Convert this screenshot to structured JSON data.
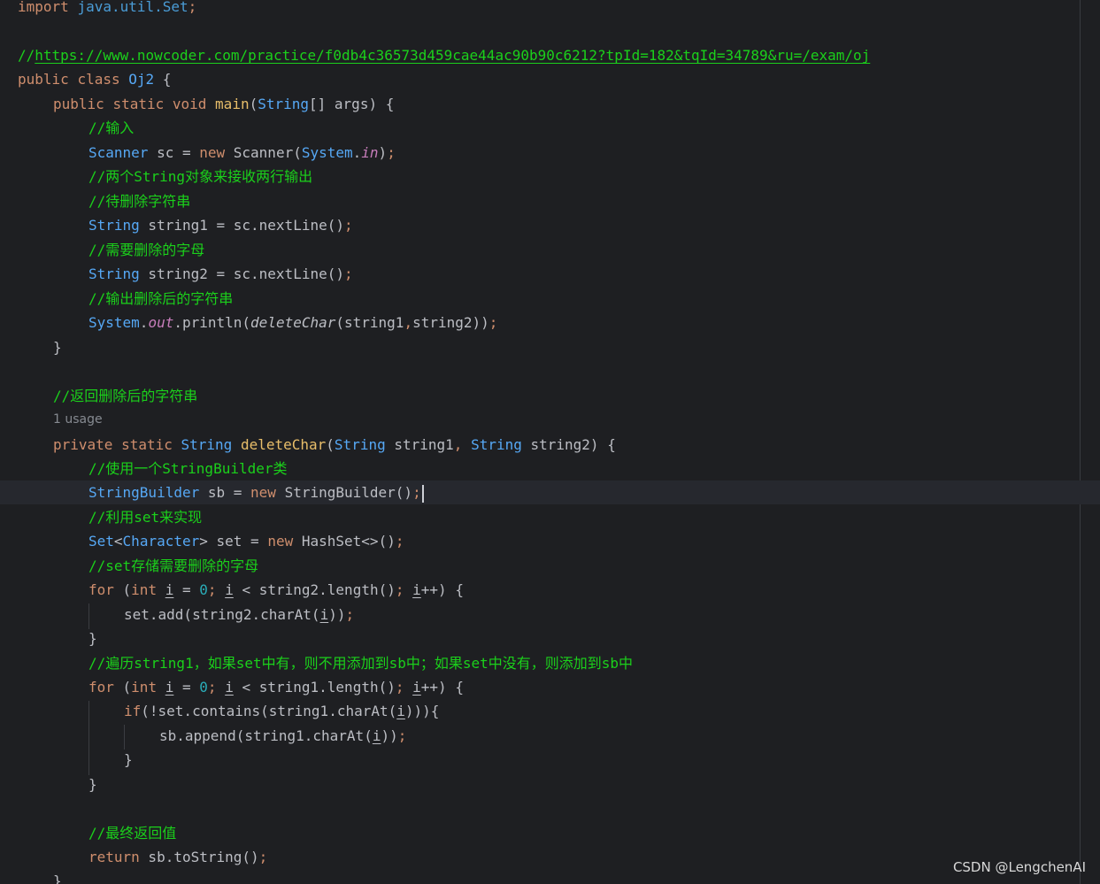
{
  "code": {
    "import_keyword": "import",
    "import_target": "java.util.Set",
    "url_comment_prefix": "//",
    "url": "https://www.nowcoder.com/practice/f0db4c36573d459cae44ac90b90c6212?tpId=182&tqId=34789&ru=/exam/oj",
    "class_decl": {
      "kw1": "public",
      "kw2": "class",
      "name": "Oj2",
      "brace": " {"
    },
    "main_decl": {
      "kw1": "public",
      "kw2": "static",
      "kw3": "void",
      "name": "main",
      "param_type": "String",
      "rest": "[] args) {"
    },
    "c_input": "//输入",
    "scanner_line": {
      "type": "Scanner",
      "var": " sc = ",
      "new": "new",
      "ctor": " Scanner(",
      "sys": "System",
      "dot": ".",
      "field": "in",
      "close": ")"
    },
    "c_two_strings": "//两个String对象来接收两行输出",
    "c_to_delete": "//待删除字符串",
    "s1_line": {
      "type": "String",
      "rest": " string1 = sc.nextLine()"
    },
    "c_chars": "//需要删除的字母",
    "s2_line": {
      "type": "String",
      "rest": " string2 = sc.nextLine()"
    },
    "c_output": "//输出删除后的字符串",
    "print_line": {
      "sys": "System",
      "dot": ".",
      "field": "out",
      "call": ".println(",
      "fn": "deleteChar",
      "args1": "(string1",
      "comma": ",",
      "args2": "string2))"
    },
    "close_brace": "}",
    "c_return_deleted": "//返回删除后的字符串",
    "usage_hint": "1 usage",
    "delete_decl": {
      "kw1": "private",
      "kw2": "static",
      "ret": "String",
      "name": "deleteChar",
      "open": "(",
      "t1": "String",
      "p1": " string1",
      "comma": ",",
      "t2": "String",
      "p2": " string2) {"
    },
    "c_use_sb": "//使用一个StringBuilder类",
    "sb_line": {
      "type": "StringBuilder",
      "var": " sb = ",
      "new": "new",
      "rest": " StringBuilder()"
    },
    "c_use_set": "//利用set来实现",
    "set_line": {
      "type": "Set",
      "lt": "<",
      "gen": "Character",
      "gt": ">",
      "var": " set = ",
      "new": "new",
      "rest": " HashSet<>()"
    },
    "c_set_store": "//set存储需要删除的字母",
    "for1": {
      "kw": "for",
      "open": " (",
      "int": "int",
      "i1": "i",
      "eq": " = ",
      "zero": "0",
      "i2": "i",
      "cond": " < string2.length()",
      "i3": "i",
      "tail": "++) {"
    },
    "add_line": {
      "pre": "set.add(string2.charAt(",
      "i": "i",
      "post": "))"
    },
    "c_traverse": "//遍历string1，如果set中有，则不用添加到sb中；如果set中没有，则添加到sb中",
    "for2": {
      "kw": "for",
      "open": " (",
      "int": "int",
      "i1": "i",
      "eq": " = ",
      "zero": "0",
      "i2": "i",
      "cond": " < string1.length()",
      "i3": "i",
      "tail": "++) {"
    },
    "if_line": {
      "kw": "if",
      "pre": "(!set.contains(string1.charAt(",
      "i": "i",
      "post": "))){"
    },
    "append_line": {
      "pre": "sb.append(string1.charAt(",
      "i": "i",
      "post": "))"
    },
    "c_final": "//最终返回值",
    "return_line": {
      "kw": "return",
      "rest": " sb.toString()"
    },
    "semicolon": ";"
  },
  "watermark": "CSDN @LengchenAI",
  "colors": {
    "background": "#1e1f22",
    "keyword": "#cf8e6d",
    "type": "#56a8f5",
    "function": "#e8be6a",
    "comment": "#1bd01b",
    "number": "#2aacb8",
    "field": "#c77dbb",
    "text": "#bcbec4"
  }
}
